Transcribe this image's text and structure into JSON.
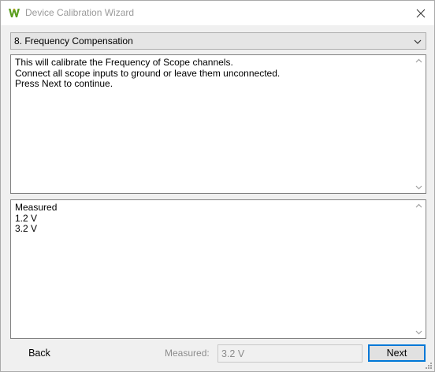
{
  "window": {
    "title": "Device Calibration Wizard",
    "icon": "app-logo-icon",
    "close_icon": "close-icon"
  },
  "step_select": {
    "selected": "8. Frequency Compensation",
    "icon": "chevron-down-icon"
  },
  "info": {
    "text": "This will calibrate the Frequency of Scope channels.\nConnect all scope inputs to ground or leave them unconnected.\nPress Next to continue."
  },
  "measurements": {
    "text": "Measured\n1.2 V\n3.2 V"
  },
  "footer": {
    "back_label": "Back",
    "measured_label": "Measured:",
    "measured_value": "3.2 V",
    "next_label": "Next"
  },
  "colors": {
    "accent": "#0078d7",
    "logo_green": "#5a9e1f",
    "disabled_text": "#8c8c8c"
  }
}
